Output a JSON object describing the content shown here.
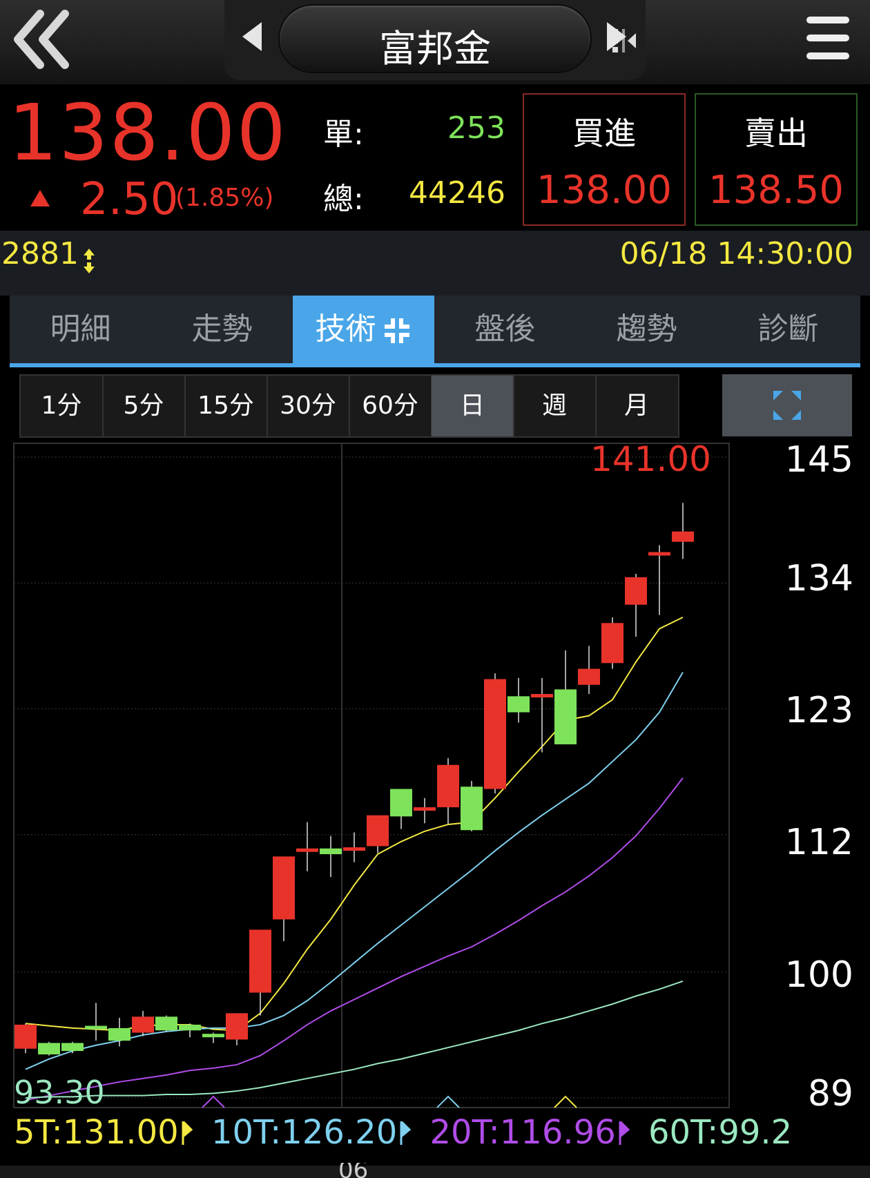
{
  "header": {
    "title": "富邦金",
    "icons": [
      "double-chevron-left-icon",
      "triangle-left-icon",
      "split-icon",
      "triangle-right-icon",
      "hamburger-menu-icon"
    ]
  },
  "quote": {
    "price": "138.00",
    "change": "2.50",
    "change_pct": "(1.85%)",
    "single_label": "單:",
    "single_value": "253",
    "total_label": "總:",
    "total_value": "44246",
    "bid_label": "買進",
    "bid_value": "138.00",
    "ask_label": "賣出",
    "ask_value": "138.50",
    "up_color": "#e8332a",
    "down_color": "#7ee35a"
  },
  "info": {
    "code": "2881",
    "datetime": "06/18 14:30:00"
  },
  "tabs": [
    {
      "label": "明細",
      "active": false
    },
    {
      "label": "走勢",
      "active": false
    },
    {
      "label": "技術",
      "active": true
    },
    {
      "label": "盤後",
      "active": false
    },
    {
      "label": "趨勢",
      "active": false
    },
    {
      "label": "診斷",
      "active": false
    }
  ],
  "periods": [
    {
      "label": "1分"
    },
    {
      "label": "5分"
    },
    {
      "label": "15分"
    },
    {
      "label": "30分"
    },
    {
      "label": "60分"
    },
    {
      "label": "日",
      "selected": true
    },
    {
      "label": "週"
    },
    {
      "label": "月"
    }
  ],
  "chart_data": {
    "type": "candlestick",
    "y_axis_labels": [
      "145",
      "134",
      "123",
      "112",
      "100",
      "89"
    ],
    "high_label": "141.00",
    "low_label": "93.30",
    "x_axis_partial_label": "06",
    "candles": [
      {
        "o": 93.3,
        "h": 95.5,
        "l": 92.9,
        "c": 95.4
      },
      {
        "o": 93.8,
        "h": 93.9,
        "l": 92.7,
        "c": 92.8
      },
      {
        "o": 93.8,
        "h": 93.9,
        "l": 92.9,
        "c": 93.1
      },
      {
        "o": 95.3,
        "h": 97.3,
        "l": 94.0,
        "c": 95.0
      },
      {
        "o": 95.1,
        "h": 96.0,
        "l": 93.5,
        "c": 94.0
      },
      {
        "o": 94.7,
        "h": 96.6,
        "l": 94.4,
        "c": 96.1
      },
      {
        "o": 96.1,
        "h": 96.2,
        "l": 94.8,
        "c": 94.9
      },
      {
        "o": 95.4,
        "h": 95.5,
        "l": 94.3,
        "c": 94.9
      },
      {
        "o": 94.6,
        "h": 94.7,
        "l": 93.8,
        "c": 94.3
      },
      {
        "o": 94.1,
        "h": 96.4,
        "l": 93.6,
        "c": 96.4
      },
      {
        "o": 98.2,
        "h": 98.3,
        "l": 96.2,
        "c": 103.7
      },
      {
        "o": 104.6,
        "h": 110.0,
        "l": 102.7,
        "c": 110.1
      },
      {
        "o": 110.8,
        "h": 113.1,
        "l": 108.8,
        "c": 110.8
      },
      {
        "o": 110.8,
        "h": 111.9,
        "l": 108.3,
        "c": 110.3
      },
      {
        "o": 110.9,
        "h": 112.2,
        "l": 109.6,
        "c": 110.9
      },
      {
        "o": 111.0,
        "h": 113.1,
        "l": 110.4,
        "c": 113.7
      },
      {
        "o": 116.0,
        "h": 116.0,
        "l": 112.5,
        "c": 113.6
      },
      {
        "o": 114.1,
        "h": 115.2,
        "l": 113.0,
        "c": 114.4
      },
      {
        "o": 114.4,
        "h": 118.7,
        "l": 112.9,
        "c": 118.1
      },
      {
        "o": 116.2,
        "h": 116.7,
        "l": 112.3,
        "c": 112.4
      },
      {
        "o": 116.0,
        "h": 126.1,
        "l": 115.6,
        "c": 125.6
      },
      {
        "o": 124.1,
        "h": 125.7,
        "l": 121.8,
        "c": 122.7
      },
      {
        "o": 124.0,
        "h": 125.7,
        "l": 119.2,
        "c": 124.3
      },
      {
        "o": 124.7,
        "h": 128.1,
        "l": 119.9,
        "c": 119.9
      },
      {
        "o": 125.1,
        "h": 128.5,
        "l": 124.3,
        "c": 126.5
      },
      {
        "o": 127.0,
        "h": 131.0,
        "l": 126.5,
        "c": 130.5
      },
      {
        "o": 132.1,
        "h": 134.8,
        "l": 129.3,
        "c": 134.5
      },
      {
        "o": 136.7,
        "h": 137.3,
        "l": 131.2,
        "c": 136.7
      },
      {
        "o": 137.6,
        "h": 141.0,
        "l": 136.1,
        "c": 138.5
      }
    ],
    "series": [
      {
        "name": "5T",
        "color": "#f4e842",
        "values": [
          95.5,
          95.3,
          95.1,
          95.0,
          94.9,
          95.3,
          95.4,
          95.4,
          95.0,
          94.9,
          96.4,
          99.0,
          102.0,
          104.6,
          107.6,
          110.3,
          111.4,
          112.3,
          112.9,
          113.1,
          115.2,
          117.5,
          119.7,
          122.0,
          122.4,
          123.8,
          127.1,
          130.0,
          131.0
        ]
      },
      {
        "name": "10T",
        "color": "#7fd0ee",
        "values": [
          91.5,
          92.4,
          93.1,
          93.6,
          94.0,
          94.5,
          94.8,
          95.0,
          95.1,
          95.1,
          95.4,
          96.2,
          97.5,
          99.1,
          100.8,
          102.5,
          104.1,
          105.7,
          107.3,
          108.9,
          110.6,
          112.2,
          113.7,
          115.1,
          116.5,
          118.4,
          120.3,
          122.7,
          126.2
        ]
      },
      {
        "name": "20T",
        "color": "#b04ce8",
        "values": [
          88.8,
          89.2,
          89.6,
          90.0,
          90.4,
          90.7,
          91.0,
          91.4,
          91.6,
          91.9,
          92.7,
          94.0,
          95.4,
          96.6,
          97.6,
          98.6,
          99.6,
          100.5,
          101.4,
          102.2,
          103.3,
          104.5,
          105.8,
          107.0,
          108.4,
          110.0,
          111.9,
          114.3,
          116.96
        ]
      },
      {
        "name": "60T",
        "color": "#9be8c0",
        "values": [
          89.0,
          89.1,
          89.1,
          89.2,
          89.2,
          89.2,
          89.3,
          89.3,
          89.4,
          89.6,
          89.9,
          90.3,
          90.7,
          91.1,
          91.5,
          92.0,
          92.4,
          92.9,
          93.4,
          93.9,
          94.4,
          94.9,
          95.5,
          96.0,
          96.6,
          97.2,
          97.9,
          98.5,
          99.2
        ]
      }
    ],
    "legend": [
      {
        "label": "5T:131.00"
      },
      {
        "label": "10T:126.20"
      },
      {
        "label": "20T:116.96"
      },
      {
        "label": "60T:99.2"
      }
    ]
  }
}
